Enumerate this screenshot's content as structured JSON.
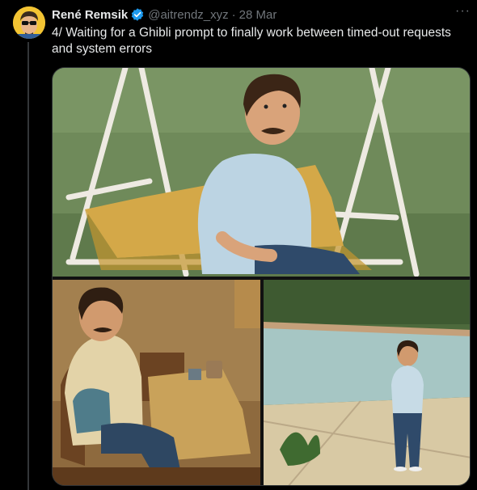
{
  "tweet": {
    "author_name": "René Remsik",
    "handle": "@aitrendz_xyz",
    "separator": "·",
    "date": "28 Mar",
    "text": "4/ Waiting for a Ghibli prompt to finally work between timed-out requests and system errors",
    "more_label": "···"
  },
  "icons": {
    "verified": "verified-badge-icon",
    "more": "more-options-icon"
  },
  "colors": {
    "background": "#000000",
    "text_primary": "#e7e9ea",
    "text_secondary": "#71767b",
    "verified_blue": "#1d9bf0",
    "avatar_bg": "#f3c433",
    "thread_line": "#333639"
  }
}
